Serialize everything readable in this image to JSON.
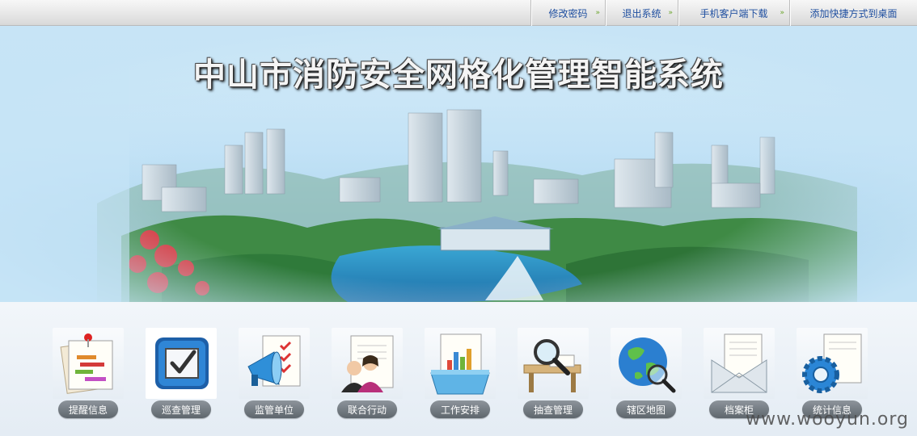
{
  "topnav": [
    {
      "label": "修改密码"
    },
    {
      "label": "退出系统"
    },
    {
      "label": "手机客户端下载"
    },
    {
      "label": "添加快捷方式到桌面"
    }
  ],
  "banner": {
    "title": "中山市消防安全网格化管理智能系统"
  },
  "modules": [
    {
      "label": "提醒信息",
      "icon": "reminder-icon"
    },
    {
      "label": "巡查管理",
      "icon": "checkbox-icon",
      "selected": true
    },
    {
      "label": "监管单位",
      "icon": "megaphone-icon"
    },
    {
      "label": "联合行动",
      "icon": "people-icon"
    },
    {
      "label": "工作安排",
      "icon": "chart-folder-icon"
    },
    {
      "label": "抽查管理",
      "icon": "magnifier-icon"
    },
    {
      "label": "辖区地图",
      "icon": "globe-icon"
    },
    {
      "label": "档案柜",
      "icon": "mail-icon"
    },
    {
      "label": "统计信息",
      "icon": "gear-icon"
    }
  ],
  "watermark": "www.wooyun.org"
}
